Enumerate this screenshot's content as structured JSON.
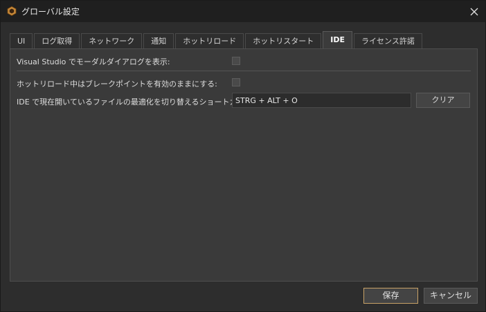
{
  "window": {
    "title": "グローバル設定",
    "app_icon": "app-logo-icon",
    "close_icon": "close-icon"
  },
  "tabs": [
    {
      "label": "UI",
      "active": false
    },
    {
      "label": "ログ取得",
      "active": false
    },
    {
      "label": "ネットワーク",
      "active": false
    },
    {
      "label": "通知",
      "active": false
    },
    {
      "label": "ホットリロード",
      "active": false
    },
    {
      "label": "ホットリスタート",
      "active": false
    },
    {
      "label": "IDE",
      "active": true
    },
    {
      "label": "ライセンス許諾",
      "active": false
    }
  ],
  "ide": {
    "show_modal_label": "Visual Studio でモーダルダイアログを表示:",
    "show_modal_checked": false,
    "keep_breakpoints_label": "ホットリロード中はブレークポイントを有効のままにする:",
    "keep_breakpoints_checked": false,
    "shortcut_label": "IDE で現在開いているファイルの最適化を切り替えるショートカット:",
    "shortcut_value": "STRG + ALT + O",
    "clear_label": "クリア"
  },
  "footer": {
    "save_label": "保存",
    "cancel_label": "キャンセル"
  },
  "colors": {
    "accent_border": "#c8a267",
    "background": "#2d2d2d",
    "panel": "#3a3a3a"
  }
}
